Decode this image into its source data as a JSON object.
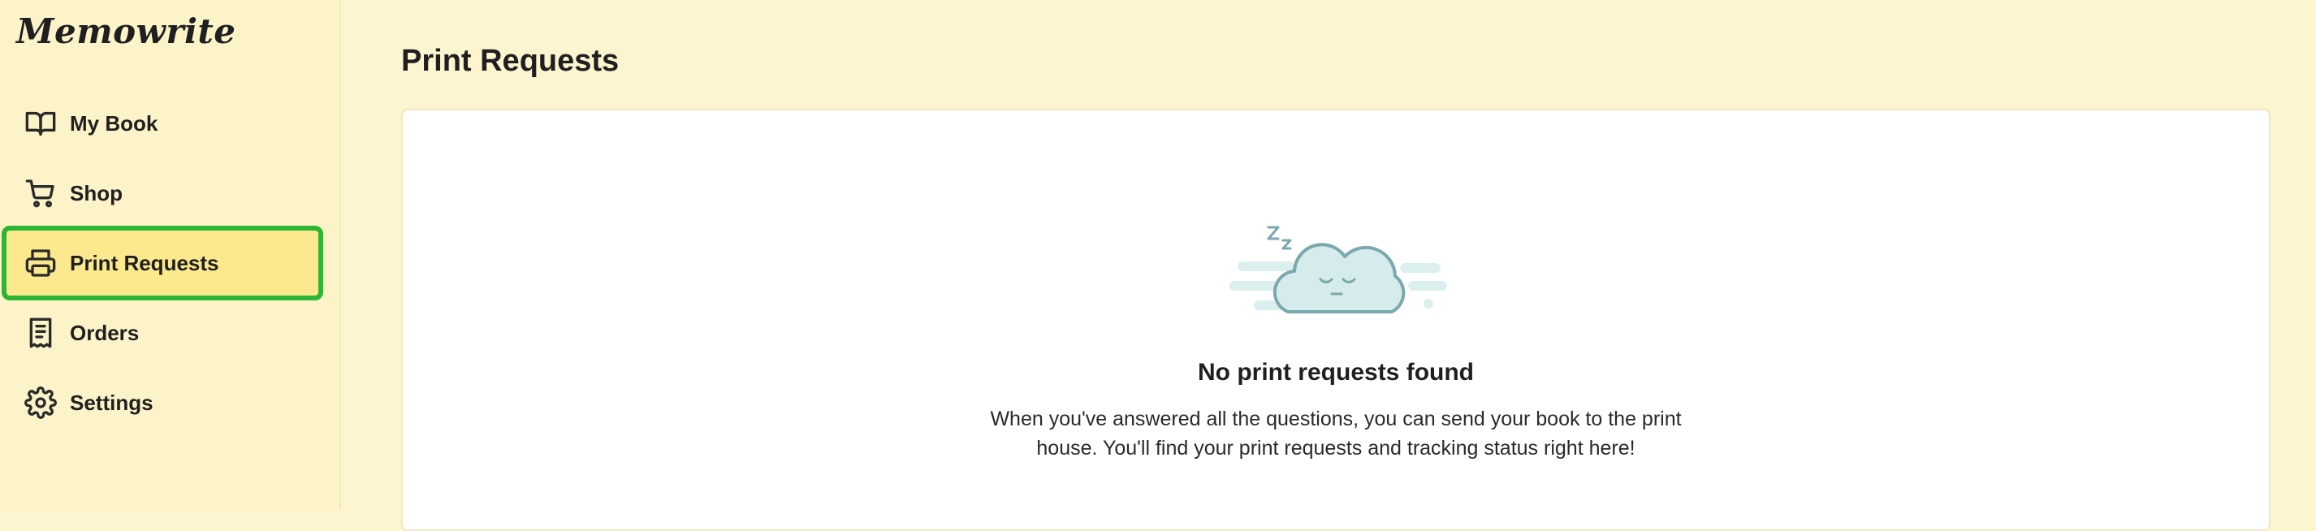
{
  "app": {
    "name": "Memowrite"
  },
  "sidebar": {
    "items": [
      {
        "label": "My Book",
        "icon": "book-icon"
      },
      {
        "label": "Shop",
        "icon": "cart-icon"
      },
      {
        "label": "Print Requests",
        "icon": "printer-icon",
        "active": true
      },
      {
        "label": "Orders",
        "icon": "receipt-icon"
      },
      {
        "label": "Settings",
        "icon": "gear-icon"
      }
    ]
  },
  "main": {
    "title": "Print Requests",
    "empty_state": {
      "illustration": "sleeping-cloud-icon",
      "title": "No print requests found",
      "description": "When you've answered all the questions, you can send your book to the print house. You'll find your print requests and tracking status right here!"
    }
  },
  "colors": {
    "background": "#fdf5cf",
    "sidebar_bg": "#fdf3c9",
    "active_bg": "#fce98e",
    "active_outline": "#2fb536",
    "card_bg": "#ffffff",
    "illustration_fill": "#d6ecec",
    "illustration_stroke": "#7aa9ad"
  }
}
